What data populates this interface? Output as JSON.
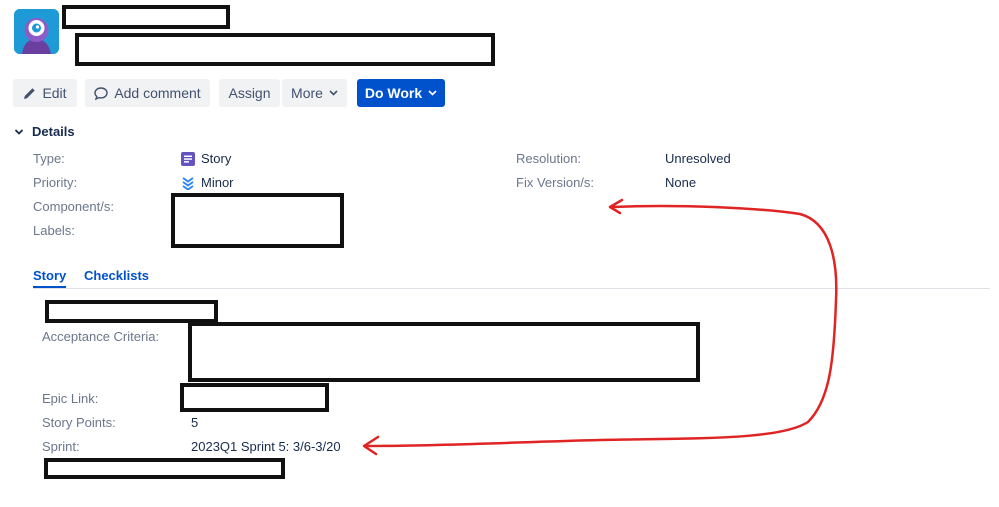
{
  "toolbar": {
    "edit_label": "Edit",
    "comment_label": "Add comment",
    "assign_label": "Assign",
    "more_label": "More",
    "do_work_label": "Do Work"
  },
  "details": {
    "heading": "Details",
    "left": [
      {
        "label": "Type:",
        "value": "Story",
        "icon": "story-icon"
      },
      {
        "label": "Priority:",
        "value": "Minor",
        "icon": "priority-minor-icon"
      },
      {
        "label": "Component/s:",
        "value": ""
      },
      {
        "label": "Labels:",
        "value": ""
      }
    ],
    "right": [
      {
        "label": "Resolution:",
        "value": "Unresolved"
      },
      {
        "label": "Fix Version/s:",
        "value": "None"
      }
    ]
  },
  "tabs": [
    {
      "label": "Story",
      "active": true
    },
    {
      "label": "Checklists",
      "active": false
    }
  ],
  "story_fields": [
    {
      "label": "Acceptance Criteria:",
      "value": ""
    },
    {
      "label": "Epic Link:",
      "value": ""
    },
    {
      "label": "Story Points:",
      "value": "5"
    },
    {
      "label": "Sprint:",
      "value": "2023Q1 Sprint 5: 3/6-3/20"
    }
  ],
  "colors": {
    "primary": "#0052cc",
    "annotation": "#e02424",
    "story_icon": "#6554c0",
    "priority_icon": "#2684ff"
  }
}
